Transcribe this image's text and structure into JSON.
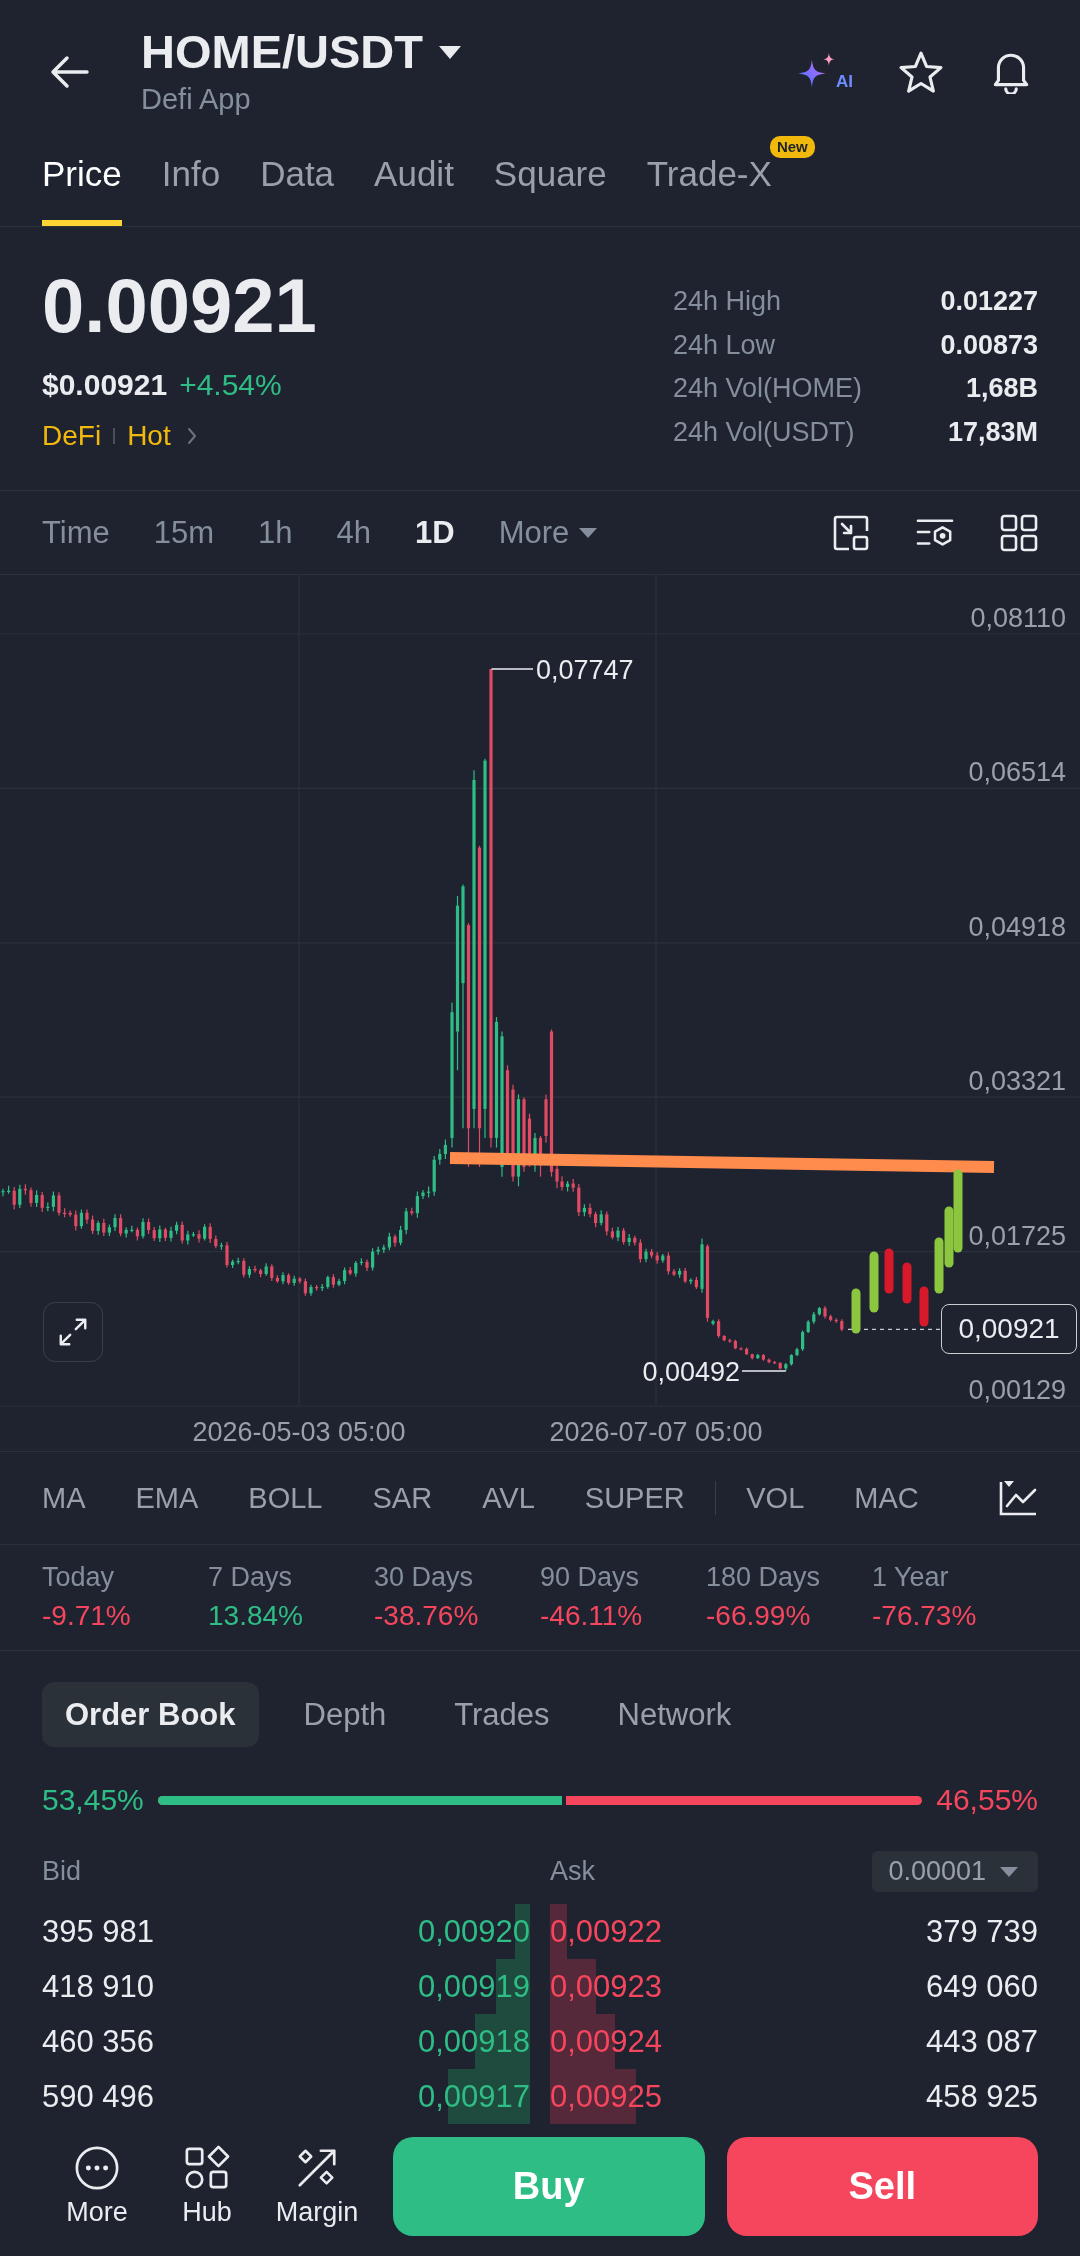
{
  "header": {
    "title": "HOME/USDT",
    "subtitle": "Defi App",
    "ai_label": "AI"
  },
  "tabs": [
    {
      "label": "Price",
      "selected": true
    },
    {
      "label": "Info",
      "selected": false
    },
    {
      "label": "Data",
      "selected": false
    },
    {
      "label": "Audit",
      "selected": false
    },
    {
      "label": "Square",
      "selected": false
    },
    {
      "label": "Trade-X",
      "selected": false,
      "badge": "New"
    }
  ],
  "ticker": {
    "price": "0.00921",
    "fiat_price": "$0.00921",
    "change": "+4.54%",
    "tags": [
      "DeFi",
      "Hot"
    ],
    "stats": [
      {
        "label": "24h High",
        "value": "0.01227"
      },
      {
        "label": "24h Low",
        "value": "0.00873"
      },
      {
        "label": "24h Vol(HOME)",
        "value": "1,68B"
      },
      {
        "label": "24h Vol(USDT)",
        "value": "17,83M"
      }
    ]
  },
  "intervals": [
    {
      "kind": "interval",
      "label": "Time",
      "selected": false
    },
    {
      "kind": "interval",
      "label": "15m",
      "selected": false
    },
    {
      "kind": "interval",
      "label": "1h",
      "selected": false
    },
    {
      "kind": "interval",
      "label": "4h",
      "selected": false
    },
    {
      "kind": "interval",
      "label": "1D",
      "selected": true
    },
    {
      "kind": "menu",
      "label": "More",
      "selected": false
    }
  ],
  "chart": {
    "price_labels": [
      "0,08110",
      "0,06514",
      "0,04918",
      "0,03321",
      "0,01725",
      "0,00129"
    ],
    "date_labels": [
      "2026-05-03 05:00",
      "2026-07-07 05:00"
    ],
    "high_label": "0,07747",
    "low_label": "0,00492",
    "last_price": "0,00921"
  },
  "indicators": {
    "main": [
      "MA",
      "EMA",
      "BOLL",
      "SAR",
      "AVL",
      "SUPER"
    ],
    "sub": [
      "VOL",
      "MAC"
    ]
  },
  "performance": [
    {
      "label": "Today",
      "value": "-9.71%",
      "color": "#f6465d"
    },
    {
      "label": "7 Days",
      "value": "13.84%",
      "color": "#2ebd85"
    },
    {
      "label": "30 Days",
      "value": "-38.76%",
      "color": "#f6465d"
    },
    {
      "label": "90 Days",
      "value": "-46.11%",
      "color": "#f6465d"
    },
    {
      "label": "180 Days",
      "value": "-66.99%",
      "color": "#f6465d"
    },
    {
      "label": "1 Year",
      "value": "-76.73%",
      "color": "#f6465d"
    }
  ],
  "book_tabs": [
    {
      "label": "Order Book",
      "selected": true
    },
    {
      "label": "Depth",
      "selected": false
    },
    {
      "label": "Trades",
      "selected": false
    },
    {
      "label": "Network",
      "selected": false
    }
  ],
  "ratio": {
    "bid": "53,45%",
    "ask": "46,55%",
    "level": 0.5345
  },
  "order_book": {
    "bid_header": "Bid",
    "ask_header": "Ask",
    "precision": "0.00001",
    "rows": [
      {
        "bid": {
          "qty": "395 981",
          "price": "0,00920"
        },
        "ask": {
          "price": "0,00922",
          "qty": "379 739"
        }
      },
      {
        "bid": {
          "qty": "418 910",
          "price": "0,00919"
        },
        "ask": {
          "price": "0,00923",
          "qty": "649 060"
        }
      },
      {
        "bid": {
          "qty": "460 356",
          "price": "0,00918"
        },
        "ask": {
          "price": "0,00924",
          "qty": "443 087"
        }
      },
      {
        "bid": {
          "qty": "590 496",
          "price": "0,00917"
        },
        "ask": {
          "price": "0,00925",
          "qty": "458 925"
        }
      }
    ]
  },
  "bottom_bar": {
    "actions": [
      {
        "kind": "more",
        "label": "More"
      },
      {
        "kind": "hub",
        "label": "Hub"
      },
      {
        "kind": "margin",
        "label": "Margin"
      }
    ],
    "buy": "Buy",
    "sell": "Sell"
  }
}
